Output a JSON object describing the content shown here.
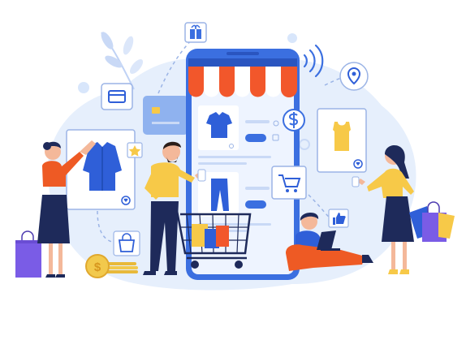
{
  "image": {
    "kind": "flat-vector-illustration",
    "subject_icons": [
      "gift-icon",
      "wallet-icon",
      "credit-card-icon",
      "location-pin-icon",
      "dollar-icon",
      "heart-icon",
      "star-icon",
      "shopping-cart-icon",
      "thumbs-up-icon",
      "shopping-bag-icon",
      "wifi-signal-icon",
      "coin-icon"
    ],
    "colors": {
      "blob": "#E6EFFC",
      "phone_frame": "#3B6FE0",
      "phone_screen": "#EEF4FF",
      "awning_orange": "#F2572B",
      "awning_white": "#FFFFFF",
      "primary_blue": "#2F5FD8",
      "yellow": "#F7C948",
      "orange_shirt": "#EE5A24",
      "navy": "#1E2A5A",
      "skin": "#F4B89A",
      "purple_bag": "#7A5CE6",
      "coin": "#F2C94C"
    }
  }
}
